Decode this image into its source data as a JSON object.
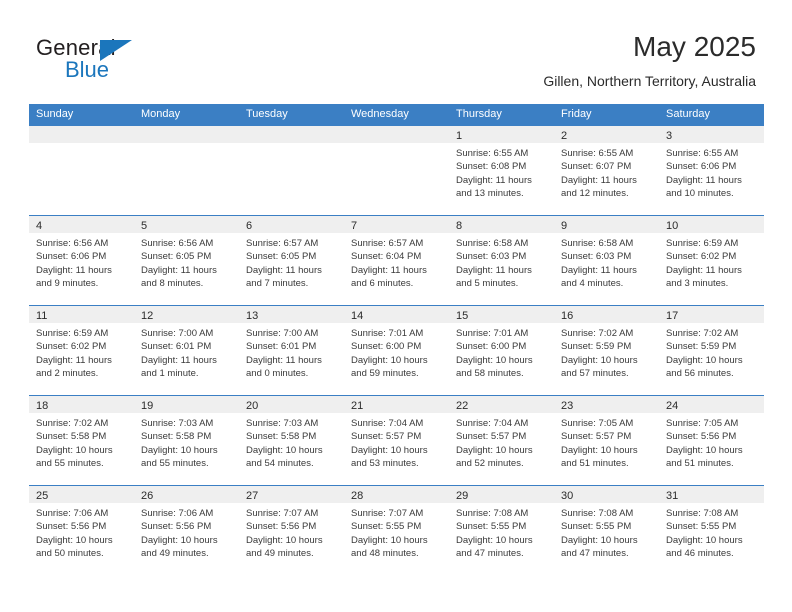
{
  "brand": {
    "name_part1": "General",
    "name_part2": "Blue",
    "triangle_icon": "triangle-icon",
    "accent_color": "#1b76bc"
  },
  "header": {
    "title": "May 2025",
    "subtitle": "Gillen, Northern Territory, Australia"
  },
  "theme": {
    "header_bar_color": "#3b7fc4",
    "day_band_color": "#efefef",
    "row_divider_color": "#3b7fc4",
    "background": "#ffffff"
  },
  "weekdays": [
    "Sunday",
    "Monday",
    "Tuesday",
    "Wednesday",
    "Thursday",
    "Friday",
    "Saturday"
  ],
  "labels": {
    "sunrise_prefix": "Sunrise:",
    "sunset_prefix": "Sunset:",
    "daylight_prefix": "Daylight:"
  },
  "weeks": [
    [
      {
        "empty": true
      },
      {
        "empty": true
      },
      {
        "empty": true
      },
      {
        "empty": true
      },
      {
        "day": "1",
        "sunrise": "Sunrise: 6:55 AM",
        "sunset": "Sunset: 6:08 PM",
        "daylight_line1": "Daylight: 11 hours",
        "daylight_line2": "and 13 minutes."
      },
      {
        "day": "2",
        "sunrise": "Sunrise: 6:55 AM",
        "sunset": "Sunset: 6:07 PM",
        "daylight_line1": "Daylight: 11 hours",
        "daylight_line2": "and 12 minutes."
      },
      {
        "day": "3",
        "sunrise": "Sunrise: 6:55 AM",
        "sunset": "Sunset: 6:06 PM",
        "daylight_line1": "Daylight: 11 hours",
        "daylight_line2": "and 10 minutes."
      }
    ],
    [
      {
        "day": "4",
        "sunrise": "Sunrise: 6:56 AM",
        "sunset": "Sunset: 6:06 PM",
        "daylight_line1": "Daylight: 11 hours",
        "daylight_line2": "and 9 minutes."
      },
      {
        "day": "5",
        "sunrise": "Sunrise: 6:56 AM",
        "sunset": "Sunset: 6:05 PM",
        "daylight_line1": "Daylight: 11 hours",
        "daylight_line2": "and 8 minutes."
      },
      {
        "day": "6",
        "sunrise": "Sunrise: 6:57 AM",
        "sunset": "Sunset: 6:05 PM",
        "daylight_line1": "Daylight: 11 hours",
        "daylight_line2": "and 7 minutes."
      },
      {
        "day": "7",
        "sunrise": "Sunrise: 6:57 AM",
        "sunset": "Sunset: 6:04 PM",
        "daylight_line1": "Daylight: 11 hours",
        "daylight_line2": "and 6 minutes."
      },
      {
        "day": "8",
        "sunrise": "Sunrise: 6:58 AM",
        "sunset": "Sunset: 6:03 PM",
        "daylight_line1": "Daylight: 11 hours",
        "daylight_line2": "and 5 minutes."
      },
      {
        "day": "9",
        "sunrise": "Sunrise: 6:58 AM",
        "sunset": "Sunset: 6:03 PM",
        "daylight_line1": "Daylight: 11 hours",
        "daylight_line2": "and 4 minutes."
      },
      {
        "day": "10",
        "sunrise": "Sunrise: 6:59 AM",
        "sunset": "Sunset: 6:02 PM",
        "daylight_line1": "Daylight: 11 hours",
        "daylight_line2": "and 3 minutes."
      }
    ],
    [
      {
        "day": "11",
        "sunrise": "Sunrise: 6:59 AM",
        "sunset": "Sunset: 6:02 PM",
        "daylight_line1": "Daylight: 11 hours",
        "daylight_line2": "and 2 minutes."
      },
      {
        "day": "12",
        "sunrise": "Sunrise: 7:00 AM",
        "sunset": "Sunset: 6:01 PM",
        "daylight_line1": "Daylight: 11 hours",
        "daylight_line2": "and 1 minute."
      },
      {
        "day": "13",
        "sunrise": "Sunrise: 7:00 AM",
        "sunset": "Sunset: 6:01 PM",
        "daylight_line1": "Daylight: 11 hours",
        "daylight_line2": "and 0 minutes."
      },
      {
        "day": "14",
        "sunrise": "Sunrise: 7:01 AM",
        "sunset": "Sunset: 6:00 PM",
        "daylight_line1": "Daylight: 10 hours",
        "daylight_line2": "and 59 minutes."
      },
      {
        "day": "15",
        "sunrise": "Sunrise: 7:01 AM",
        "sunset": "Sunset: 6:00 PM",
        "daylight_line1": "Daylight: 10 hours",
        "daylight_line2": "and 58 minutes."
      },
      {
        "day": "16",
        "sunrise": "Sunrise: 7:02 AM",
        "sunset": "Sunset: 5:59 PM",
        "daylight_line1": "Daylight: 10 hours",
        "daylight_line2": "and 57 minutes."
      },
      {
        "day": "17",
        "sunrise": "Sunrise: 7:02 AM",
        "sunset": "Sunset: 5:59 PM",
        "daylight_line1": "Daylight: 10 hours",
        "daylight_line2": "and 56 minutes."
      }
    ],
    [
      {
        "day": "18",
        "sunrise": "Sunrise: 7:02 AM",
        "sunset": "Sunset: 5:58 PM",
        "daylight_line1": "Daylight: 10 hours",
        "daylight_line2": "and 55 minutes."
      },
      {
        "day": "19",
        "sunrise": "Sunrise: 7:03 AM",
        "sunset": "Sunset: 5:58 PM",
        "daylight_line1": "Daylight: 10 hours",
        "daylight_line2": "and 55 minutes."
      },
      {
        "day": "20",
        "sunrise": "Sunrise: 7:03 AM",
        "sunset": "Sunset: 5:58 PM",
        "daylight_line1": "Daylight: 10 hours",
        "daylight_line2": "and 54 minutes."
      },
      {
        "day": "21",
        "sunrise": "Sunrise: 7:04 AM",
        "sunset": "Sunset: 5:57 PM",
        "daylight_line1": "Daylight: 10 hours",
        "daylight_line2": "and 53 minutes."
      },
      {
        "day": "22",
        "sunrise": "Sunrise: 7:04 AM",
        "sunset": "Sunset: 5:57 PM",
        "daylight_line1": "Daylight: 10 hours",
        "daylight_line2": "and 52 minutes."
      },
      {
        "day": "23",
        "sunrise": "Sunrise: 7:05 AM",
        "sunset": "Sunset: 5:57 PM",
        "daylight_line1": "Daylight: 10 hours",
        "daylight_line2": "and 51 minutes."
      },
      {
        "day": "24",
        "sunrise": "Sunrise: 7:05 AM",
        "sunset": "Sunset: 5:56 PM",
        "daylight_line1": "Daylight: 10 hours",
        "daylight_line2": "and 51 minutes."
      }
    ],
    [
      {
        "day": "25",
        "sunrise": "Sunrise: 7:06 AM",
        "sunset": "Sunset: 5:56 PM",
        "daylight_line1": "Daylight: 10 hours",
        "daylight_line2": "and 50 minutes."
      },
      {
        "day": "26",
        "sunrise": "Sunrise: 7:06 AM",
        "sunset": "Sunset: 5:56 PM",
        "daylight_line1": "Daylight: 10 hours",
        "daylight_line2": "and 49 minutes."
      },
      {
        "day": "27",
        "sunrise": "Sunrise: 7:07 AM",
        "sunset": "Sunset: 5:56 PM",
        "daylight_line1": "Daylight: 10 hours",
        "daylight_line2": "and 49 minutes."
      },
      {
        "day": "28",
        "sunrise": "Sunrise: 7:07 AM",
        "sunset": "Sunset: 5:55 PM",
        "daylight_line1": "Daylight: 10 hours",
        "daylight_line2": "and 48 minutes."
      },
      {
        "day": "29",
        "sunrise": "Sunrise: 7:08 AM",
        "sunset": "Sunset: 5:55 PM",
        "daylight_line1": "Daylight: 10 hours",
        "daylight_line2": "and 47 minutes."
      },
      {
        "day": "30",
        "sunrise": "Sunrise: 7:08 AM",
        "sunset": "Sunset: 5:55 PM",
        "daylight_line1": "Daylight: 10 hours",
        "daylight_line2": "and 47 minutes."
      },
      {
        "day": "31",
        "sunrise": "Sunrise: 7:08 AM",
        "sunset": "Sunset: 5:55 PM",
        "daylight_line1": "Daylight: 10 hours",
        "daylight_line2": "and 46 minutes."
      }
    ]
  ]
}
